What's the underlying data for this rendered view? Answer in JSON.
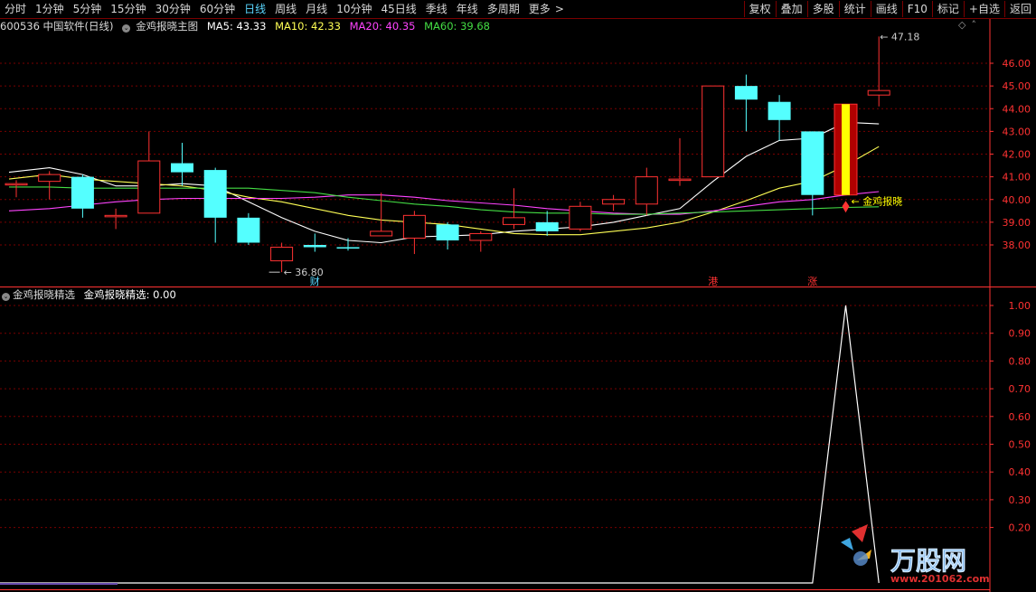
{
  "toolbar": {
    "periods": [
      {
        "label": "分时",
        "active": false
      },
      {
        "label": "1分钟",
        "active": false
      },
      {
        "label": "5分钟",
        "active": false
      },
      {
        "label": "15分钟",
        "active": false
      },
      {
        "label": "30分钟",
        "active": false
      },
      {
        "label": "60分钟",
        "active": false
      },
      {
        "label": "日线",
        "active": true
      },
      {
        "label": "周线",
        "active": false
      },
      {
        "label": "月线",
        "active": false
      },
      {
        "label": "10分钟",
        "active": false
      },
      {
        "label": "45日线",
        "active": false
      },
      {
        "label": "季线",
        "active": false
      },
      {
        "label": "年线",
        "active": false
      },
      {
        "label": "多周期",
        "active": false
      },
      {
        "label": "更多",
        "active": false
      }
    ],
    "more_arrow": ">",
    "right_buttons": [
      "复权",
      "叠加",
      "多股",
      "统计",
      "画线",
      "F10",
      "标记",
      "+自选",
      "返回"
    ]
  },
  "main_header": {
    "stock": "600536 中国软件(日线)",
    "indicator": "金鸡报晓主图",
    "ma": [
      {
        "label": "MA5: 43.33",
        "color": "#ffffff"
      },
      {
        "label": "MA10: 42.33",
        "color": "#ffff55"
      },
      {
        "label": "MA20: 40.35",
        "color": "#ff44ff"
      },
      {
        "label": "MA60: 39.68",
        "color": "#44dd44"
      }
    ]
  },
  "sub_header": {
    "indicator": "金鸡报晓精选",
    "value_text": "金鸡报晓精选: 0.00"
  },
  "colors": {
    "up": "#ff3232",
    "down": "#54ffff",
    "grid": "#7a0000",
    "axis": "#ff3232",
    "signal": "#ffff00"
  },
  "chart_data": [
    {
      "type": "candlestick",
      "title": "600536 中国软件(日线)",
      "y_ticks": [
        "46.00",
        "45.00",
        "44.00",
        "43.00",
        "42.00",
        "41.00",
        "40.00",
        "39.00",
        "38.00"
      ],
      "ylim": [
        37.0,
        47.8
      ],
      "candles": [
        {
          "o": 40.7,
          "h": 40.85,
          "l": 40.1,
          "c": 40.7
        },
        {
          "o": 40.8,
          "h": 41.25,
          "l": 40.0,
          "c": 41.1
        },
        {
          "o": 41.0,
          "h": 41.1,
          "l": 39.2,
          "c": 39.6
        },
        {
          "o": 39.3,
          "h": 39.6,
          "l": 38.7,
          "c": 39.3
        },
        {
          "o": 39.4,
          "h": 43.0,
          "l": 39.4,
          "c": 41.7
        },
        {
          "o": 41.6,
          "h": 42.5,
          "l": 40.6,
          "c": 41.2
        },
        {
          "o": 41.3,
          "h": 41.4,
          "l": 38.1,
          "c": 39.2
        },
        {
          "o": 39.2,
          "h": 39.4,
          "l": 38.0,
          "c": 38.1
        },
        {
          "o": 37.3,
          "h": 38.1,
          "l": 36.8,
          "c": 37.9
        },
        {
          "o": 38.0,
          "h": 38.5,
          "l": 37.7,
          "c": 37.9
        },
        {
          "o": 37.9,
          "h": 38.3,
          "l": 37.75,
          "c": 37.85
        },
        {
          "o": 38.4,
          "h": 40.3,
          "l": 38.4,
          "c": 38.6
        },
        {
          "o": 38.3,
          "h": 39.5,
          "l": 37.6,
          "c": 39.3
        },
        {
          "o": 38.9,
          "h": 39.0,
          "l": 37.8,
          "c": 38.2
        },
        {
          "o": 38.2,
          "h": 38.6,
          "l": 37.7,
          "c": 38.5
        },
        {
          "o": 38.9,
          "h": 40.5,
          "l": 38.7,
          "c": 39.2
        },
        {
          "o": 39.0,
          "h": 39.5,
          "l": 38.4,
          "c": 38.6
        },
        {
          "o": 38.7,
          "h": 39.9,
          "l": 38.6,
          "c": 39.7
        },
        {
          "o": 39.8,
          "h": 40.2,
          "l": 39.5,
          "c": 40.0
        },
        {
          "o": 39.8,
          "h": 41.4,
          "l": 39.3,
          "c": 41.0
        },
        {
          "o": 40.9,
          "h": 42.7,
          "l": 40.6,
          "c": 40.9
        },
        {
          "o": 41.0,
          "h": 45.0,
          "l": 41.0,
          "c": 45.0
        },
        {
          "o": 45.0,
          "h": 45.5,
          "l": 43.0,
          "c": 44.4
        },
        {
          "o": 44.3,
          "h": 44.6,
          "l": 42.6,
          "c": 43.5
        },
        {
          "o": 43.0,
          "h": 43.0,
          "l": 39.3,
          "c": 40.2
        },
        {
          "o": 40.2,
          "h": 44.2,
          "l": 40.2,
          "c": 44.2
        },
        {
          "o": 44.6,
          "h": 47.18,
          "l": 44.1,
          "c": 44.8
        }
      ],
      "series": [
        {
          "name": "MA5",
          "color": "#ffffff",
          "values": [
            41.2,
            41.4,
            41.1,
            40.6,
            40.6,
            40.7,
            40.6,
            39.9,
            39.2,
            38.6,
            38.2,
            38.1,
            38.35,
            38.4,
            38.45,
            38.6,
            38.7,
            38.8,
            39.0,
            39.3,
            39.6,
            40.8,
            41.9,
            42.6,
            42.7,
            43.4,
            43.33
          ]
        },
        {
          "name": "MA10",
          "color": "#ffff55",
          "values": [
            40.9,
            41.1,
            40.9,
            40.8,
            40.7,
            40.6,
            40.4,
            40.1,
            39.9,
            39.6,
            39.3,
            39.1,
            39.0,
            38.9,
            38.7,
            38.5,
            38.45,
            38.45,
            38.6,
            38.75,
            39.0,
            39.45,
            39.95,
            40.5,
            40.8,
            41.5,
            42.33
          ]
        },
        {
          "name": "MA20",
          "color": "#ff44ff",
          "values": [
            39.5,
            39.6,
            39.75,
            39.9,
            40.0,
            40.05,
            40.05,
            40.05,
            40.05,
            40.1,
            40.2,
            40.2,
            40.1,
            39.95,
            39.85,
            39.75,
            39.6,
            39.5,
            39.4,
            39.35,
            39.35,
            39.5,
            39.7,
            39.9,
            40.0,
            40.2,
            40.35
          ]
        },
        {
          "name": "MA60",
          "color": "#44dd44",
          "values": [
            40.55,
            40.55,
            40.5,
            40.5,
            40.5,
            40.5,
            40.5,
            40.5,
            40.4,
            40.3,
            40.1,
            39.95,
            39.8,
            39.7,
            39.55,
            39.45,
            39.4,
            39.4,
            39.35,
            39.35,
            39.4,
            39.45,
            39.5,
            39.55,
            39.6,
            39.65,
            39.68
          ]
        }
      ],
      "annotations": {
        "low_label": "36.80",
        "high_label": "47.18",
        "signal_label": "金鸡报晓",
        "markers": [
          {
            "index": 9,
            "text": "财",
            "color": "#5ad7ff"
          },
          {
            "index": 21,
            "text": "港",
            "color": "#ff3232"
          },
          {
            "index": 24,
            "text": "涨",
            "color": "#ff3232"
          }
        ]
      }
    },
    {
      "type": "line",
      "title": "金鸡报晓精选",
      "y_ticks": [
        "1.00",
        "0.90",
        "0.80",
        "0.70",
        "0.60",
        "0.50",
        "0.40",
        "0.30",
        "0.20"
      ],
      "ylim": [
        0,
        1.0
      ],
      "series": [
        {
          "name": "金鸡报晓精选",
          "color": "#ffffff",
          "values": [
            0,
            0,
            0,
            0,
            0,
            0,
            0,
            0,
            0,
            0,
            0,
            0,
            0,
            0,
            0,
            0,
            0,
            0,
            0,
            0,
            0,
            0,
            0,
            0,
            0,
            1,
            0
          ]
        }
      ]
    }
  ],
  "watermark": {
    "brand": "万股网",
    "url": "www.201062.com"
  }
}
